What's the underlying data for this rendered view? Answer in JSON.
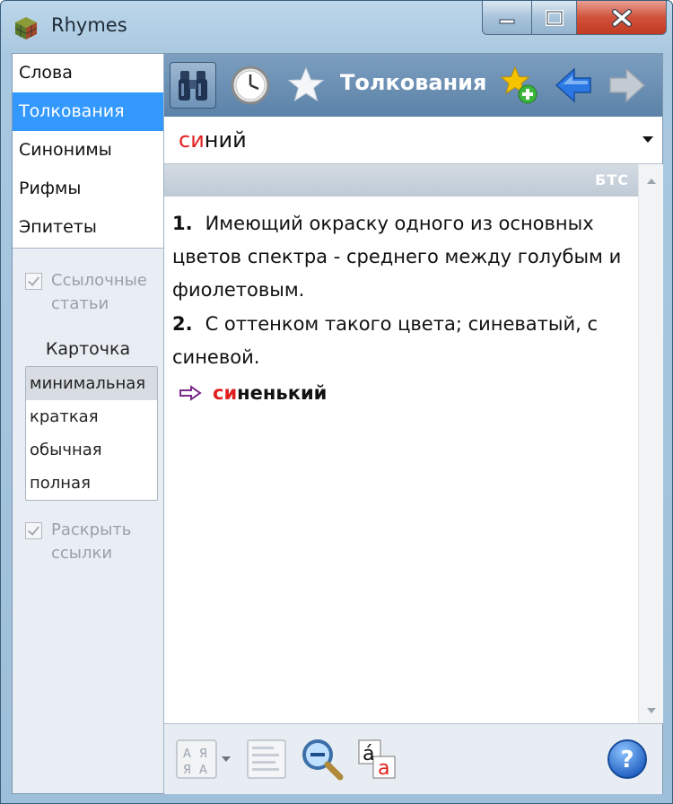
{
  "window": {
    "title": "Rhymes"
  },
  "nav": {
    "items": [
      {
        "label": "Слова",
        "selected": false
      },
      {
        "label": "Толкования",
        "selected": true
      },
      {
        "label": "Синонимы",
        "selected": false
      },
      {
        "label": "Рифмы",
        "selected": false
      },
      {
        "label": "Эпитеты",
        "selected": false
      }
    ]
  },
  "options": {
    "ref_articles_label": "Ссылочные статьи",
    "ref_articles_checked": true,
    "card_title": "Карточка",
    "card_items": [
      {
        "label": "минимальная",
        "selected": true
      },
      {
        "label": "краткая",
        "selected": false
      },
      {
        "label": "обычная",
        "selected": false
      },
      {
        "label": "полная",
        "selected": false
      }
    ],
    "expand_links_label": "Раскрыть ссылки",
    "expand_links_checked": true
  },
  "toolbar": {
    "title": "Толкования",
    "icons": [
      "binoculars-icon",
      "clock-icon",
      "star-icon",
      "add-favorite-icon",
      "back-arrow-icon",
      "forward-arrow-icon"
    ]
  },
  "search": {
    "word_highlight": "си",
    "word_rest": "ний"
  },
  "article": {
    "source": "БТС",
    "definitions": [
      {
        "num": "1.",
        "text": "Имеющий окраску одного из основных цветов спектра - среднего между голубым и фиолетовым."
      },
      {
        "num": "2.",
        "text": "С оттенком такого цвета; синеватый, с синевой."
      }
    ],
    "ref_highlight": "си",
    "ref_rest": "ненький"
  },
  "bottom": {
    "icons": [
      "font-size-icon",
      "layout-icon",
      "zoom-icon",
      "accent-icon",
      "help-icon"
    ],
    "help_label": "?"
  },
  "colors": {
    "selection": "#3399ff",
    "highlight": "#e02020",
    "toolbar": "#6a8fb4"
  }
}
